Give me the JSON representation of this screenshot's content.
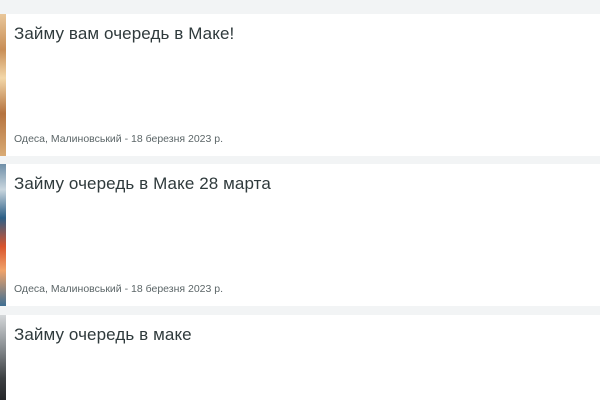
{
  "listings": [
    {
      "title": "Займу вам очередь в Маке!",
      "location": "Одеса, Малиновський",
      "date": "18 березня 2023 р.",
      "meta": "Одеса, Малиновський - 18 березня 2023 р."
    },
    {
      "title": "Займу очередь в Маке 28 марта",
      "location": "Одеса, Малиновський",
      "date": "18 березня 2023 р.",
      "meta": "Одеса, Малиновський - 18 березня 2023 р."
    },
    {
      "title": "Займу очередь в маке"
    }
  ],
  "colors": {
    "page_background": "#f2f4f5",
    "card_background": "#ffffff",
    "title_text": "#2f3a3c",
    "meta_text": "#5c6668"
  }
}
